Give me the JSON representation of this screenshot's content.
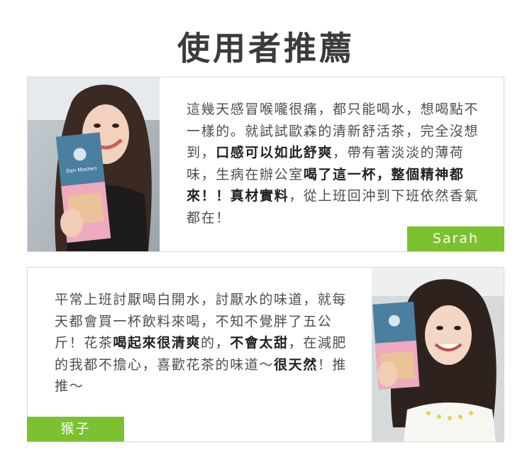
{
  "page": {
    "title": "使用者推薦"
  },
  "reviews": [
    {
      "segments": [
        {
          "text": "這幾天感冒喉嚨很痛，都只能喝水，想喝點不一樣的。就試試歐森的清新舒活茶，完全沒想到，",
          "bold": false
        },
        {
          "text": "口感可以如此舒爽",
          "bold": true
        },
        {
          "text": "，帶有著淡淡的薄荷味，生病在辦公室",
          "bold": false
        },
        {
          "text": "喝了這一杯，整個精神都來！！真材實料",
          "bold": true
        },
        {
          "text": "，從上班回沖到下班依然香氣都在！",
          "bold": false
        }
      ],
      "name": "Sarah",
      "product_label": "Dan Moshen"
    },
    {
      "segments": [
        {
          "text": "平常上班討厭喝白開水，討厭水的味道，就每天都會買一杯飲料來喝，不知不覺胖了五公斤！花茶",
          "bold": false
        },
        {
          "text": "喝起來很清爽",
          "bold": true
        },
        {
          "text": "的，",
          "bold": false
        },
        {
          "text": "不會太甜",
          "bold": true
        },
        {
          "text": "，在減肥的我都不擔心，喜歡花茶的味道～",
          "bold": false
        },
        {
          "text": "很天然",
          "bold": true
        },
        {
          "text": "！推推～",
          "bold": false
        }
      ],
      "name": "猴子"
    }
  ],
  "colors": {
    "accent": "#7cc12f",
    "border": "#d9d9d9",
    "title": "#3b3b3b"
  }
}
